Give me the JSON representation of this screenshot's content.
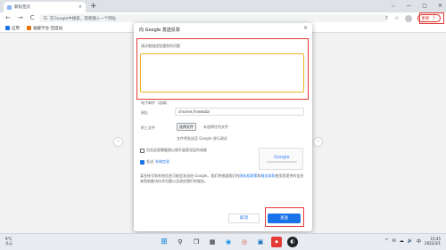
{
  "browser": {
    "tab_title": "新标签页",
    "tab_close": "×",
    "new_tab": "+",
    "window_controls": [
      "⌵",
      "—",
      "▢",
      "✕"
    ],
    "nav": {
      "back": "←",
      "forward": "→",
      "reload": "C"
    },
    "omnibox_icon": "G",
    "omnibox_placeholder": "在Google中搜索，或者输入一个网址",
    "share_icon": "⇧",
    "bookmark_icon": "☆",
    "update_label": "更新",
    "update_dots": "⋮"
  },
  "bookmarks": [
    {
      "label": "应用",
      "icon": "apps-grid-icon"
    },
    {
      "label": "福耀学台-百度站",
      "icon": "bookmark-icon"
    }
  ],
  "dialog": {
    "title": "向 Google 发送反馈",
    "close": "×",
    "description_label": "请详细描述您遇到的问题",
    "email_option": "电子邮件（选填）",
    "url_label": "网址",
    "url_value": "chrome://newtab/",
    "attach_label": "附上文件",
    "choose_file": "选择文件",
    "no_file": "未选择任何文件",
    "attach_note": "文件将发送至 Google 进行调试",
    "screenshot_option": "包含此屏幕截图以便开展更深层的调查",
    "system_info_prefix": "发送",
    "system_info_link": "系统信息",
    "screenshot_logo": "Google",
    "footer_prefix": "某些帐号和系统信息可能会发送给 Google。我们将根据我们的",
    "footer_link_privacy": "隐私权政策",
    "footer_mid": "和",
    "footer_link_terms": "服务条款",
    "footer_suffix": "使用您提供的信息来帮助解决技术问题以及改进我们的服务。",
    "cancel": "取消",
    "send": "发送"
  },
  "page": {
    "left_arrow": "‹",
    "right_arrow": "›"
  },
  "taskbar": {
    "weather_temp": "9°C",
    "weather_desc": "多云",
    "apps": [
      {
        "glyph": "⊞",
        "name": "start"
      },
      {
        "glyph": "⚲",
        "name": "search"
      },
      {
        "glyph": "❐",
        "name": "task-view"
      },
      {
        "glyph": "▦",
        "name": "widgets"
      },
      {
        "glyph": "◉",
        "name": "edge"
      },
      {
        "glyph": "◎",
        "name": "chrome"
      },
      {
        "glyph": "▣",
        "name": "store"
      },
      {
        "glyph": "◆",
        "name": "app"
      },
      {
        "glyph": "◐",
        "name": "active-app"
      }
    ],
    "tray_icons": [
      "^",
      "✉",
      "☁",
      "🔊",
      "中"
    ],
    "time": "15:45",
    "date": "2022/3/1"
  },
  "colors": {
    "accent": "#1a73e8",
    "highlight": "#e53935"
  }
}
